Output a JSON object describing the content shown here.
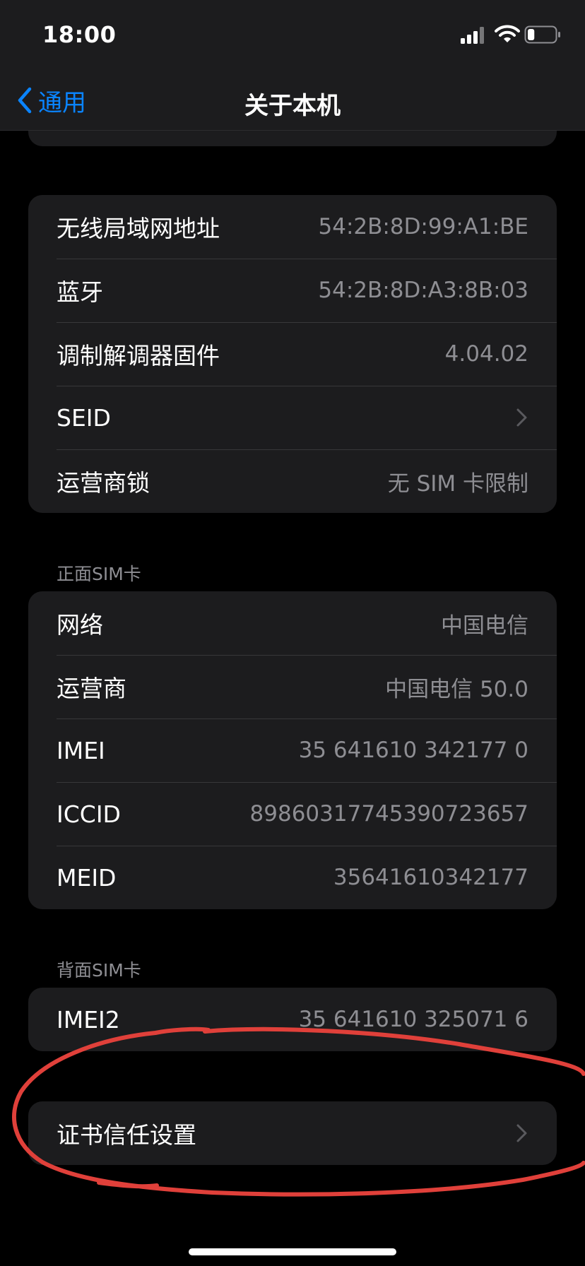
{
  "status_bar": {
    "time": "18:00",
    "battery_level": 0.25
  },
  "nav": {
    "back_label": "通用",
    "title": "关于本机"
  },
  "network_group": {
    "rows": [
      {
        "label": "无线局域网地址",
        "value": "54:2B:8D:99:A1:BE"
      },
      {
        "label": "蓝牙",
        "value": "54:2B:8D:A3:8B:03"
      },
      {
        "label": "调制解调器固件",
        "value": "4.04.02"
      },
      {
        "label": "SEID"
      },
      {
        "label": "运营商锁",
        "value": "无 SIM 卡限制"
      }
    ]
  },
  "front_sim": {
    "header": "正面SIM卡",
    "rows": [
      {
        "label": "网络",
        "value": "中国电信"
      },
      {
        "label": "运营商",
        "value": "中国电信 50.0"
      },
      {
        "label": "IMEI",
        "value": "35 641610 342177 0"
      },
      {
        "label": "ICCID",
        "value": "89860317745390723657"
      },
      {
        "label": "MEID",
        "value": "35641610342177"
      }
    ]
  },
  "back_sim": {
    "header": "背面SIM卡",
    "rows": [
      {
        "label": "IMEI2",
        "value": "35 641610 325071 6"
      }
    ]
  },
  "cert_group": {
    "rows": [
      {
        "label": "证书信任设置"
      }
    ]
  },
  "colors": {
    "accent": "#0a84ff",
    "background": "#000000",
    "card": "#1c1c1e",
    "secondary_text": "#8e8e93",
    "annotation": "#e0403a"
  },
  "icons": [
    "cellular-signal-icon",
    "wifi-icon",
    "battery-icon",
    "chevron-left-icon",
    "chevron-right-icon"
  ]
}
